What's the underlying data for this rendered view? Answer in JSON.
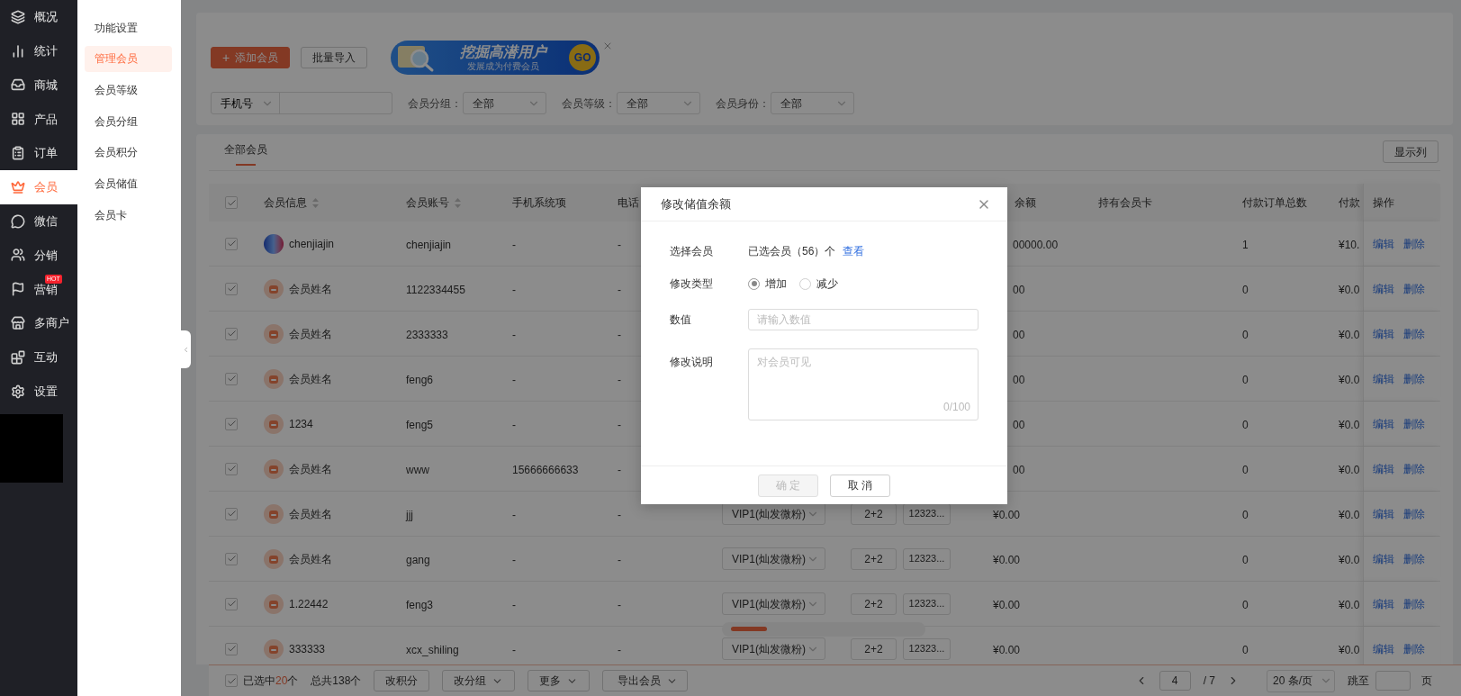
{
  "sidebar": {
    "items": [
      {
        "label": "概况",
        "selected": false
      },
      {
        "label": "统计",
        "selected": false
      },
      {
        "label": "商城",
        "selected": false
      },
      {
        "label": "产品",
        "selected": false
      },
      {
        "label": "订单",
        "selected": false
      },
      {
        "label": "会员",
        "selected": true
      },
      {
        "label": "微信",
        "selected": false
      },
      {
        "label": "分销",
        "selected": false
      },
      {
        "label": "营销",
        "selected": false,
        "badge": "HOT"
      },
      {
        "label": "多商户",
        "selected": false
      },
      {
        "label": "互动",
        "selected": false
      },
      {
        "label": "设置",
        "selected": false
      }
    ]
  },
  "submenu": {
    "items": [
      {
        "label": "功能设置",
        "selected": false
      },
      {
        "label": "管理会员",
        "selected": true
      },
      {
        "label": "会员等级",
        "selected": false
      },
      {
        "label": "会员分组",
        "selected": false
      },
      {
        "label": "会员积分",
        "selected": false
      },
      {
        "label": "会员储值",
        "selected": false
      },
      {
        "label": "会员卡",
        "selected": false
      }
    ]
  },
  "toolbar": {
    "buttons": [
      {
        "label": "添加会员",
        "kind": "primary",
        "icon_text": "+"
      },
      {
        "label": "批量导入",
        "kind": "default"
      }
    ],
    "banner": {
      "title": "挖掘高潜用户",
      "subtitle": "发展成为付费会员",
      "action": "GO"
    }
  },
  "filters": {
    "search_type": "手机号",
    "selects": [
      {
        "label": "会员分组：",
        "value": "全部"
      },
      {
        "label": "会员等级：",
        "value": "全部"
      },
      {
        "label": "会员身份：",
        "value": "全部"
      }
    ]
  },
  "tabs": [
    {
      "label": "全部会员",
      "selected": true
    }
  ],
  "column_button": "显示列",
  "table": {
    "header_checked": true,
    "columns": [
      {
        "label": "会员信息",
        "sortable": true
      },
      {
        "label": "会员账号",
        "sortable": true
      },
      {
        "label": "手机系统项",
        "sortable": false
      },
      {
        "label": "电话",
        "sortable": false
      },
      {
        "label": "余额",
        "sortable": false
      },
      {
        "label": "持有会员卡",
        "sortable": false
      },
      {
        "label": "付款订单总数",
        "sortable": false
      },
      {
        "label": "付款",
        "sortable": false
      },
      {
        "label": "操作",
        "sortable": false
      }
    ],
    "rows": [
      {
        "checked": true,
        "photo": true,
        "name": "chenjiajin",
        "account": "chenjiajin",
        "phone_field": "-",
        "tel": "-",
        "balance": "00000.00",
        "orders": "1",
        "paid": "¥10.",
        "actions": [
          "编辑",
          "删除"
        ]
      },
      {
        "checked": true,
        "photo": false,
        "name": "会员姓名",
        "account": "1122334455",
        "phone_field": "-",
        "tel": "-",
        "balance": "00",
        "orders": "0",
        "paid": "¥0.0",
        "actions": [
          "编辑",
          "删除"
        ]
      },
      {
        "checked": true,
        "photo": false,
        "name": "会员姓名",
        "account": "2333333",
        "phone_field": "-",
        "tel": "-",
        "balance": "00",
        "orders": "0",
        "paid": "¥0.0",
        "actions": [
          "编辑",
          "删除"
        ]
      },
      {
        "checked": true,
        "photo": false,
        "name": "会员姓名",
        "account": "feng6",
        "phone_field": "-",
        "tel": "-",
        "balance": "00",
        "orders": "0",
        "paid": "¥0.0",
        "actions": [
          "编辑",
          "删除"
        ]
      },
      {
        "checked": true,
        "photo": false,
        "name": "1234",
        "account": "feng5",
        "phone_field": "-",
        "tel": "-",
        "balance": "00",
        "orders": "0",
        "paid": "¥0.0",
        "actions": [
          "编辑",
          "删除"
        ]
      },
      {
        "checked": true,
        "photo": false,
        "name": "会员姓名",
        "account": "www",
        "phone_field": "15666666633",
        "tel": "-",
        "balance": "00",
        "orders": "0",
        "paid": "¥0.0",
        "actions": [
          "编辑",
          "删除"
        ]
      },
      {
        "checked": true,
        "photo": false,
        "name": "会员姓名",
        "account": "jjj",
        "phone_field": "-",
        "tel": "-",
        "level": "VIP1(灿发微粉)",
        "tag": "2+2",
        "card_no": "12323...",
        "balance": "¥0.00",
        "orders": "0",
        "paid": "¥0.0",
        "actions": [
          "编辑",
          "删除"
        ]
      },
      {
        "checked": true,
        "photo": false,
        "name": "会员姓名",
        "account": "gang",
        "phone_field": "-",
        "tel": "-",
        "level": "VIP1(灿发微粉)",
        "tag": "2+2",
        "card_no": "12323...",
        "balance": "¥0.00",
        "orders": "0",
        "paid": "¥0.0",
        "actions": [
          "编辑",
          "删除"
        ]
      },
      {
        "checked": true,
        "photo": false,
        "name": "1.22442",
        "account": "feng3",
        "phone_field": "-",
        "tel": "-",
        "level": "VIP1(灿发微粉)",
        "tag": "2+2",
        "card_no": "12323...",
        "balance": "¥0.00",
        "orders": "0",
        "paid": "¥0.0",
        "actions": [
          "编辑",
          "删除"
        ]
      },
      {
        "checked": true,
        "photo": false,
        "name": "333333",
        "account": "xcx_shiling",
        "phone_field": "-",
        "tel": "-",
        "level": "VIP1(灿发微粉)",
        "tag": "2+2",
        "card_no": "12323...",
        "balance": "¥0.00",
        "orders": "0",
        "paid": "¥0.0",
        "actions": [
          "编辑",
          "删除"
        ]
      }
    ]
  },
  "footer": {
    "checked": true,
    "selected_prefix": "已选中",
    "selected_count": "20",
    "selected_suffix": "个",
    "total": "总共138个",
    "buttons": [
      {
        "label": "改积分",
        "kind": "plain"
      },
      {
        "label": "改分组",
        "kind": "dropdown"
      },
      {
        "label": "更多",
        "kind": "dropdown"
      },
      {
        "label": "导出会员",
        "kind": "dropdown"
      }
    ],
    "pagination": {
      "page": "4",
      "total": "/ 7",
      "page_size": "20 条/页",
      "jump_label": "跳至",
      "jump_suffix": "页"
    }
  },
  "dialog": {
    "title": "修改储值余额",
    "fields": [
      {
        "kind": "members",
        "label": "选择会员",
        "text": "已选会员（56）个",
        "link": "查看"
      },
      {
        "kind": "radio",
        "label": "修改类型",
        "options": [
          {
            "label": "增加",
            "selected": true
          },
          {
            "label": "减少",
            "selected": false
          }
        ]
      },
      {
        "kind": "input",
        "label": "数值",
        "placeholder": "请输入数值"
      },
      {
        "kind": "textarea",
        "label": "修改说明",
        "placeholder": "对会员可见",
        "counter": "0/100"
      }
    ],
    "buttons": [
      {
        "label": "确 定",
        "disabled": true
      },
      {
        "label": "取 消",
        "disabled": false
      }
    ]
  }
}
